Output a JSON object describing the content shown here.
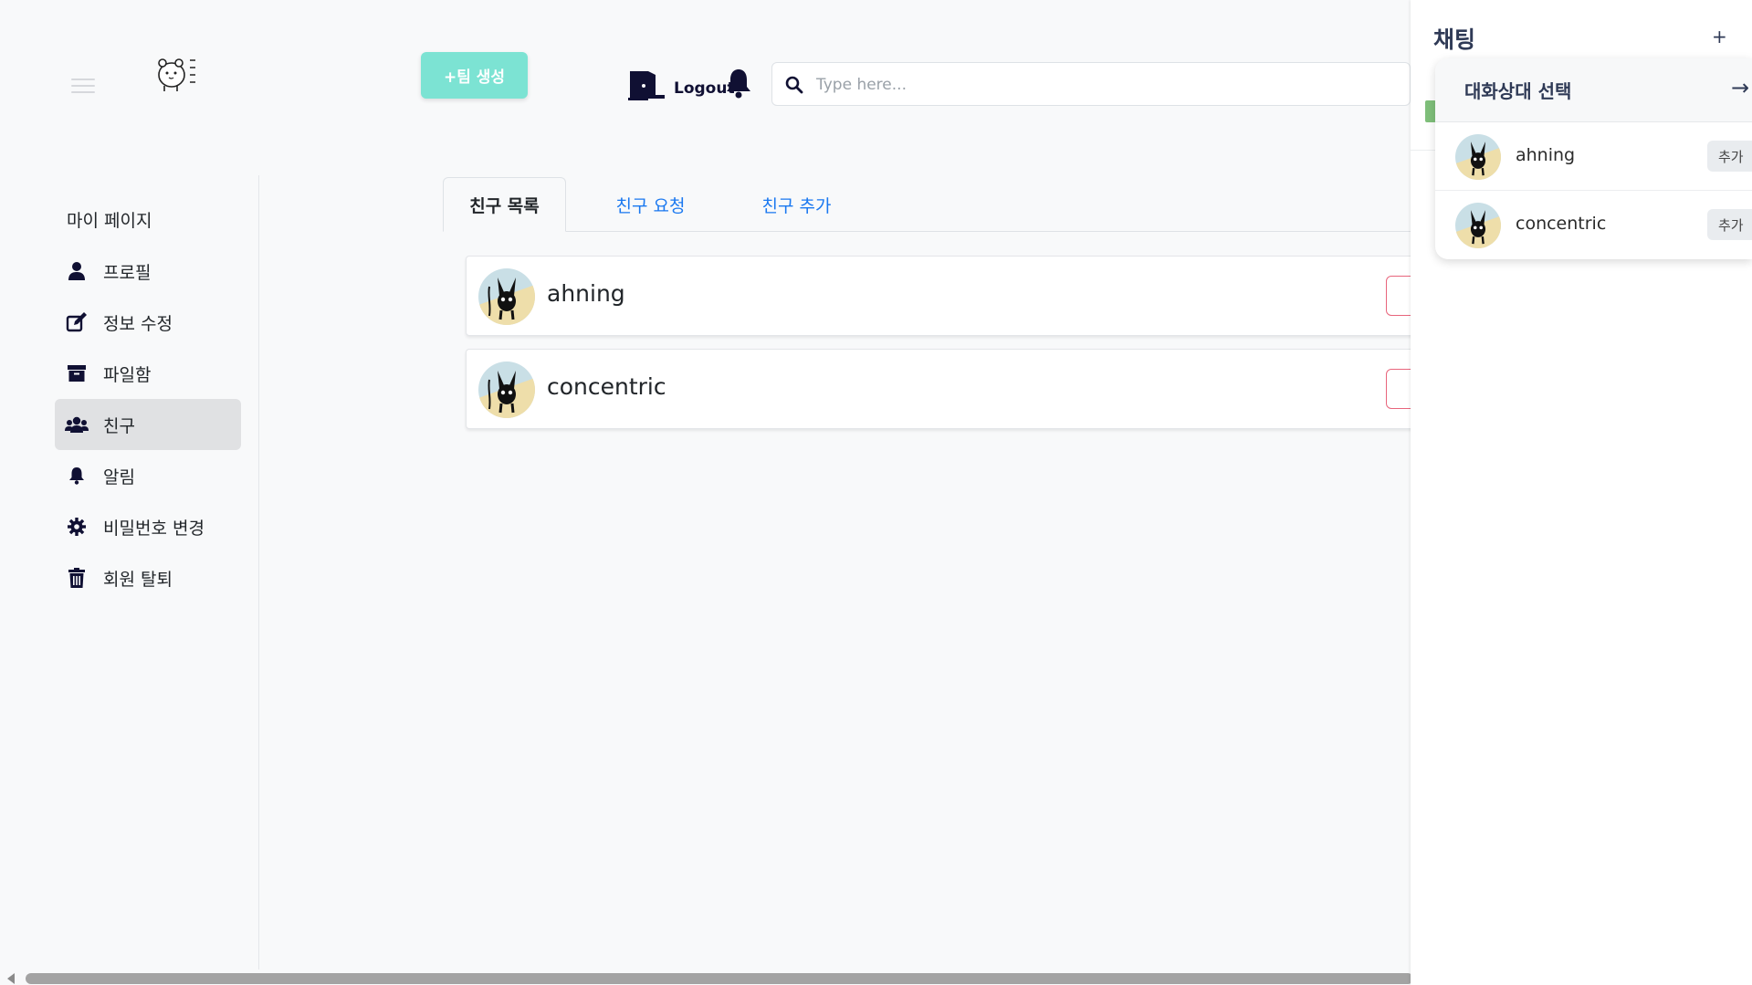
{
  "header": {
    "team_button_label": "+팀 생성",
    "logout_label": "Logout",
    "search_placeholder": "Type here..."
  },
  "sidebar": {
    "title": "마이 페이지",
    "items": [
      {
        "label": "프로필",
        "icon": "user-icon",
        "active": false
      },
      {
        "label": "정보 수정",
        "icon": "edit-icon",
        "active": false
      },
      {
        "label": "파일함",
        "icon": "archive-icon",
        "active": false
      },
      {
        "label": "친구",
        "icon": "users-icon",
        "active": true
      },
      {
        "label": "알림",
        "icon": "bell-icon",
        "active": false
      },
      {
        "label": "비밀번호 변경",
        "icon": "gear-icon",
        "active": false
      },
      {
        "label": "회원 탈퇴",
        "icon": "trash-icon",
        "active": false
      }
    ]
  },
  "tabs": [
    {
      "label": "친구 목록",
      "active": true
    },
    {
      "label": "친구 요청",
      "active": false
    },
    {
      "label": "친구 추가",
      "active": false
    }
  ],
  "friends": [
    {
      "name": "ahning"
    },
    {
      "name": "concentric"
    }
  ],
  "chat": {
    "title": "채팅",
    "add_label": "+",
    "picker": {
      "title": "대화상대 선택",
      "arrow": "→",
      "items": [
        {
          "name": "ahning",
          "add_label": "추가"
        },
        {
          "name": "concentric",
          "add_label": "추가"
        }
      ]
    }
  },
  "colors": {
    "accent_teal": "#7ce3d3",
    "link_blue": "#1a78f0",
    "danger_outline": "#e8657c",
    "navy": "#2f3a56"
  }
}
